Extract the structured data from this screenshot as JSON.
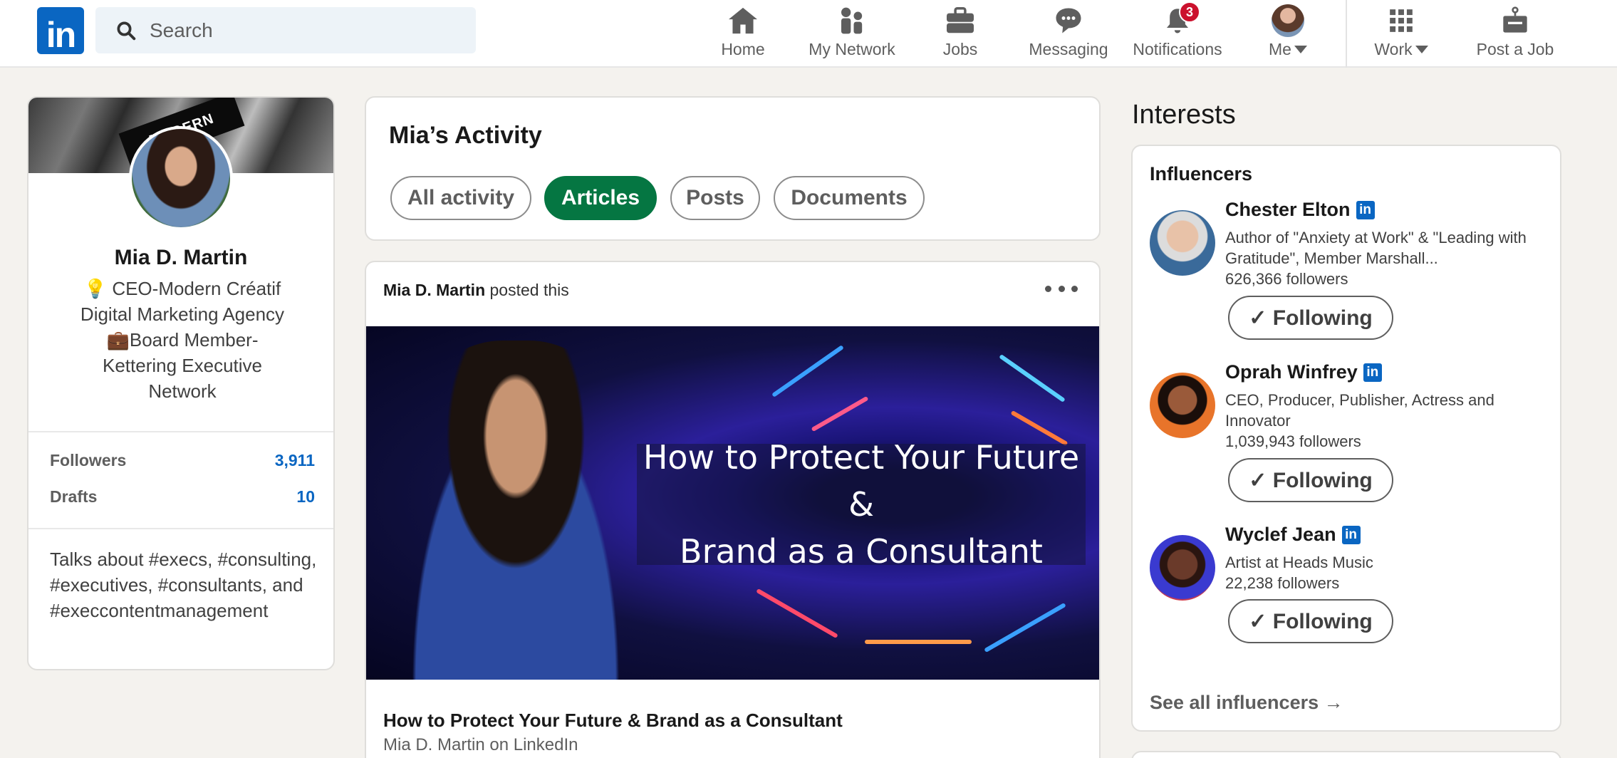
{
  "nav": {
    "logo_text": "in",
    "search": {
      "placeholder": "Search"
    },
    "items": [
      {
        "label": "Home",
        "icon": "home-icon"
      },
      {
        "label": "My Network",
        "icon": "people-icon"
      },
      {
        "label": "Jobs",
        "icon": "briefcase-icon"
      },
      {
        "label": "Messaging",
        "icon": "chat-icon"
      },
      {
        "label": "Notifications",
        "icon": "bell-icon",
        "badge": "3"
      },
      {
        "label": "Me",
        "icon": "avatar"
      },
      {
        "label": "Work",
        "icon": "grid-icon"
      },
      {
        "label": "Post a Job",
        "icon": "job-post-icon"
      }
    ]
  },
  "profile": {
    "cover_text": "MODERN",
    "name": "Mia D. Martin",
    "headline_line1": "💡 CEO-Modern Créatif",
    "headline_line2": "Digital Marketing Agency",
    "headline_line3": "💼Board Member-",
    "headline_line4": "Kettering Executive",
    "headline_line5": "Network",
    "stats": [
      {
        "label": "Followers",
        "value": "3,911"
      },
      {
        "label": "Drafts",
        "value": "10"
      }
    ],
    "about": "Talks about #execs, #consulting, #executives, #consultants, and #execcontentmanagement"
  },
  "activity": {
    "title": "Mia’s Activity",
    "filters": [
      "All activity",
      "Articles",
      "Posts",
      "Documents"
    ],
    "active_filter": "Articles"
  },
  "post": {
    "author": "Mia D. Martin",
    "action": " posted this",
    "image_line1": "How to Protect Your Future &",
    "image_line2": "Brand as a Consultant",
    "title": "How to Protect Your Future & Brand as a Consultant",
    "subtitle": "Mia D. Martin on LinkedIn"
  },
  "interests": {
    "title": "Interests",
    "section": "Influencers",
    "influencers": [
      {
        "name": "Chester Elton",
        "desc": "Author of \"Anxiety at Work\" & \"Leading with Gratitude\", Member Marshall...",
        "followers": "626,366 followers",
        "button": "✓ Following"
      },
      {
        "name": "Oprah Winfrey",
        "desc": "CEO, Producer, Publisher, Actress and Innovator",
        "followers": "1,039,943 followers",
        "button": "✓ Following"
      },
      {
        "name": "Wyclef Jean",
        "desc": "Artist at Heads Music",
        "followers": "22,238 followers",
        "button": "✓ Following"
      }
    ],
    "see_all": "See all influencers →"
  },
  "colors": {
    "brand": "#0a66c2",
    "active_pill": "#057642",
    "badge": "#cb112d",
    "background": "#f4f2ee"
  }
}
